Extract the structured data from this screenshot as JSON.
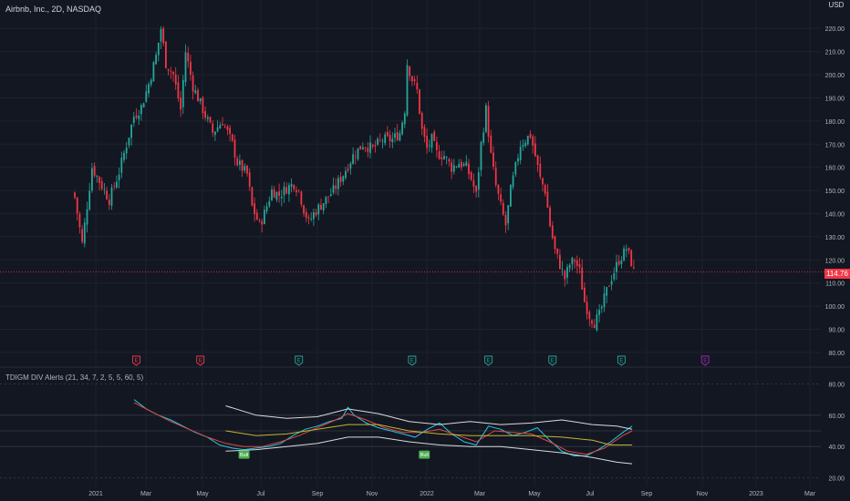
{
  "header": {
    "title": "Airbnb, Inc., 2D, NASDAQ",
    "currency": "USD"
  },
  "last_price": "114.76",
  "indicator_title": "TDIGM DIV Alerts (21, 34, 7, 2, 5, 5, 60, 5)",
  "colors": {
    "up": "#26a69a",
    "down": "#f23645",
    "bg": "#131722",
    "grid": "#1e222d",
    "cyan": "#1fc8e8",
    "red": "#e0483e",
    "yellow": "#c9b233",
    "band": "#d9d9d9",
    "bull": "#4caf50",
    "earn_e": "#9c27b0"
  },
  "chart_data": [
    {
      "type": "candlestick",
      "ylim": [
        78,
        226
      ],
      "y_ticks": [
        "220.00",
        "210.00",
        "200.00",
        "190.00",
        "180.00",
        "170.00",
        "160.00",
        "150.00",
        "140.00",
        "130.00",
        "120.00",
        "110.00",
        "100.00",
        "90.00",
        "80.00"
      ],
      "x_labels": [
        "2021",
        "Mar",
        "May",
        "Jul",
        "Sep",
        "Nov",
        "2022",
        "Mar",
        "May",
        "Jul",
        "Sep",
        "Nov",
        "2023",
        "Mar"
      ],
      "close_path": [
        [
          0,
          147
        ],
        [
          3,
          127
        ],
        [
          7,
          160
        ],
        [
          11,
          152
        ],
        [
          14,
          146
        ],
        [
          18,
          158
        ],
        [
          21,
          170
        ],
        [
          24,
          182
        ],
        [
          27,
          186
        ],
        [
          30,
          196
        ],
        [
          33,
          208
        ],
        [
          35,
          220
        ],
        [
          37,
          205
        ],
        [
          40,
          200
        ],
        [
          43,
          185
        ],
        [
          45,
          210
        ],
        [
          48,
          195
        ],
        [
          52,
          185
        ],
        [
          56,
          175
        ],
        [
          60,
          180
        ],
        [
          64,
          170
        ],
        [
          66,
          162
        ],
        [
          70,
          157
        ],
        [
          72,
          143
        ],
        [
          75,
          135
        ],
        [
          77,
          140
        ],
        [
          80,
          150
        ],
        [
          83,
          148
        ],
        [
          86,
          151
        ],
        [
          89,
          153
        ],
        [
          91,
          150
        ],
        [
          93,
          142
        ],
        [
          95,
          136
        ],
        [
          97,
          140
        ],
        [
          101,
          145
        ],
        [
          105,
          150
        ],
        [
          109,
          157
        ],
        [
          113,
          165
        ],
        [
          117,
          170
        ],
        [
          121,
          168
        ],
        [
          125,
          172
        ],
        [
          129,
          172
        ],
        [
          132,
          175
        ],
        [
          134,
          185
        ],
        [
          135,
          205
        ],
        [
          137,
          198
        ],
        [
          139,
          193
        ],
        [
          141,
          176
        ],
        [
          143,
          168
        ],
        [
          145,
          172
        ],
        [
          147,
          166
        ],
        [
          150,
          165
        ],
        [
          153,
          160
        ],
        [
          156,
          162
        ],
        [
          159,
          160
        ],
        [
          161,
          155
        ],
        [
          163,
          148
        ],
        [
          165,
          170
        ],
        [
          167,
          185
        ],
        [
          169,
          165
        ],
        [
          171,
          152
        ],
        [
          173,
          143
        ],
        [
          175,
          135
        ],
        [
          177,
          150
        ],
        [
          179,
          160
        ],
        [
          181,
          170
        ],
        [
          183,
          172
        ],
        [
          185,
          174
        ],
        [
          187,
          165
        ],
        [
          189,
          155
        ],
        [
          191,
          150
        ],
        [
          193,
          135
        ],
        [
          195,
          124
        ],
        [
          197,
          118
        ],
        [
          199,
          112
        ],
        [
          201,
          118
        ],
        [
          203,
          120
        ],
        [
          205,
          115
        ],
        [
          207,
          102
        ],
        [
          209,
          96
        ],
        [
          211,
          93
        ],
        [
          213,
          96
        ],
        [
          215,
          103
        ],
        [
          217,
          110
        ],
        [
          219,
          115
        ],
        [
          221,
          120
        ],
        [
          223,
          123
        ],
        [
          224,
          125
        ],
        [
          226,
          119
        ],
        [
          227,
          114.76
        ]
      ],
      "earnings_markers": [
        {
          "bar": 25,
          "label": "E",
          "color": "#f23645"
        },
        {
          "bar": 51,
          "label": "E",
          "color": "#f23645"
        },
        {
          "bar": 91,
          "label": "E",
          "color": "#26a69a"
        },
        {
          "bar": 137,
          "label": "E",
          "color": "#26a69a"
        },
        {
          "bar": 168,
          "label": "E",
          "color": "#26a69a"
        },
        {
          "bar": 194,
          "label": "E",
          "color": "#26a69a"
        },
        {
          "bar": 222,
          "label": "E",
          "color": "#26a69a"
        },
        {
          "bar": 256,
          "label": "E",
          "color": "#9c27b0"
        }
      ]
    },
    {
      "type": "line",
      "title": "TDIGM DIV Alerts (21, 34, 7, 2, 5, 5, 60, 5)",
      "ylim": [
        18,
        82
      ],
      "y_ticks": [
        "80.00",
        "60.00",
        "40.00",
        "20.00"
      ],
      "levels": [
        80,
        60,
        50,
        40,
        20
      ],
      "series": [
        {
          "color": "#1fc8e8",
          "points": [
            [
              0,
              70
            ],
            [
              4,
              64
            ],
            [
              8,
              60
            ],
            [
              12,
              57
            ],
            [
              16,
              53
            ],
            [
              20,
              49
            ],
            [
              24,
              46
            ],
            [
              28,
              41
            ],
            [
              32,
              39
            ],
            [
              36,
              38
            ],
            [
              40,
              39
            ],
            [
              44,
              40
            ],
            [
              48,
              42
            ],
            [
              52,
              47
            ],
            [
              56,
              51
            ],
            [
              60,
              53
            ],
            [
              64,
              56
            ],
            [
              68,
              58
            ],
            [
              70,
              65
            ],
            [
              72,
              60
            ],
            [
              76,
              55
            ],
            [
              80,
              52
            ],
            [
              84,
              50
            ],
            [
              88,
              48
            ],
            [
              92,
              46
            ],
            [
              96,
              51
            ],
            [
              100,
              55
            ],
            [
              104,
              48
            ],
            [
              108,
              43
            ],
            [
              112,
              41
            ],
            [
              116,
              53
            ],
            [
              120,
              51
            ],
            [
              124,
              47
            ],
            [
              128,
              49
            ],
            [
              132,
              52
            ],
            [
              136,
              44
            ],
            [
              140,
              37
            ],
            [
              144,
              34
            ],
            [
              148,
              34
            ],
            [
              152,
              38
            ],
            [
              156,
              43
            ],
            [
              160,
              49
            ],
            [
              163,
              53
            ]
          ]
        },
        {
          "color": "#e0483e",
          "points": [
            [
              0,
              68
            ],
            [
              6,
              62
            ],
            [
              12,
              56
            ],
            [
              18,
              51
            ],
            [
              24,
              46
            ],
            [
              30,
              42
            ],
            [
              36,
              40
            ],
            [
              42,
              40
            ],
            [
              48,
              43
            ],
            [
              54,
              47
            ],
            [
              60,
              52
            ],
            [
              66,
              57
            ],
            [
              70,
              61
            ],
            [
              76,
              57
            ],
            [
              82,
              52
            ],
            [
              88,
              49
            ],
            [
              94,
              49
            ],
            [
              100,
              51
            ],
            [
              106,
              47
            ],
            [
              112,
              43
            ],
            [
              118,
              50
            ],
            [
              124,
              49
            ],
            [
              130,
              48
            ],
            [
              136,
              43
            ],
            [
              142,
              37
            ],
            [
              148,
              35
            ],
            [
              154,
              39
            ],
            [
              160,
              47
            ],
            [
              163,
              50
            ]
          ]
        },
        {
          "color": "#c9b233",
          "points": [
            [
              30,
              50
            ],
            [
              40,
              47
            ],
            [
              50,
              48
            ],
            [
              60,
              51
            ],
            [
              70,
              54
            ],
            [
              80,
              54
            ],
            [
              90,
              50
            ],
            [
              100,
              48
            ],
            [
              110,
              47
            ],
            [
              120,
              47
            ],
            [
              130,
              47
            ],
            [
              140,
              46
            ],
            [
              150,
              44
            ],
            [
              156,
              41
            ],
            [
              163,
              41
            ]
          ]
        },
        {
          "color": "#d9d9d9",
          "points": [
            [
              30,
              66
            ],
            [
              40,
              60
            ],
            [
              50,
              58
            ],
            [
              60,
              59
            ],
            [
              70,
              64
            ],
            [
              80,
              61
            ],
            [
              90,
              56
            ],
            [
              100,
              54
            ],
            [
              110,
              56
            ],
            [
              120,
              54
            ],
            [
              130,
              55
            ],
            [
              140,
              57
            ],
            [
              150,
              54
            ],
            [
              158,
              53
            ],
            [
              163,
              51
            ]
          ]
        },
        {
          "color": "#d9d9d9",
          "points": [
            [
              30,
              37
            ],
            [
              40,
              38
            ],
            [
              50,
              40
            ],
            [
              60,
              42
            ],
            [
              70,
              46
            ],
            [
              80,
              46
            ],
            [
              90,
              43
            ],
            [
              100,
              41
            ],
            [
              110,
              40
            ],
            [
              120,
              40
            ],
            [
              130,
              38
            ],
            [
              140,
              36
            ],
            [
              150,
              33
            ],
            [
              158,
              30
            ],
            [
              163,
              29
            ]
          ]
        }
      ],
      "bull_markers": [
        {
          "x": 36,
          "value": 38,
          "label": "Bull"
        },
        {
          "x": 95,
          "value": 38,
          "label": "Bull"
        }
      ]
    }
  ]
}
